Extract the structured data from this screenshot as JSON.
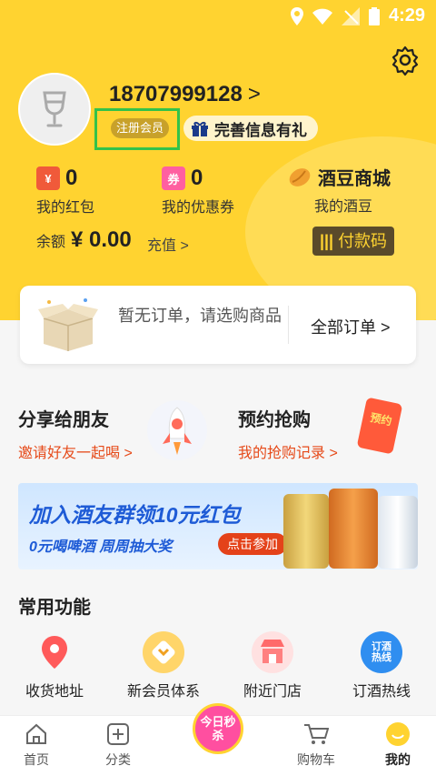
{
  "status": {
    "time": "4:29"
  },
  "profile": {
    "phone": "18707999128",
    "phone_chevron": ">",
    "member_badge": "注册会员",
    "gift_text": "完善信息有礼"
  },
  "stats": {
    "red_packet": {
      "count": "0",
      "label": "我的红包",
      "icon_text": "¥"
    },
    "coupon": {
      "count": "0",
      "label": "我的优惠券",
      "icon_text": "券"
    },
    "jiudou": {
      "title": "酒豆商城",
      "label": "我的酒豆"
    }
  },
  "balance": {
    "label": "余额",
    "amount": "¥ 0.00",
    "recharge": "充值 >",
    "paycode": "付款码"
  },
  "order": {
    "empty_text": "暂无订单，请选购商品",
    "all_orders": "全部订单 >"
  },
  "features": [
    {
      "title": "分享给朋友",
      "sub": "邀请好友一起喝 >"
    },
    {
      "title": "预约抢购",
      "sub": "我的抢购记录 >",
      "card_text": "预约"
    }
  ],
  "banner": {
    "title": "加入酒友群领10元红包",
    "subtitle": "0元喝啤酒 周周抽大奖",
    "button": "点击参加"
  },
  "common": {
    "title": "常用功能",
    "items": [
      {
        "label": "收货地址",
        "icon": "location-pin-icon"
      },
      {
        "label": "新会员体系",
        "icon": "member-chevron-icon"
      },
      {
        "label": "附近门店",
        "icon": "store-icon"
      },
      {
        "label": "订酒热线",
        "icon": "hotline-icon",
        "icon_text": "订酒热线"
      }
    ]
  },
  "tabbar": {
    "items": [
      {
        "label": "首页"
      },
      {
        "label": "分类"
      },
      {
        "label": "今日秒杀"
      },
      {
        "label": "购物车"
      },
      {
        "label": "我的"
      }
    ]
  },
  "colors": {
    "accent": "#ffd330",
    "orange_text": "#e64a19",
    "member_badge": "#c8a12a"
  }
}
